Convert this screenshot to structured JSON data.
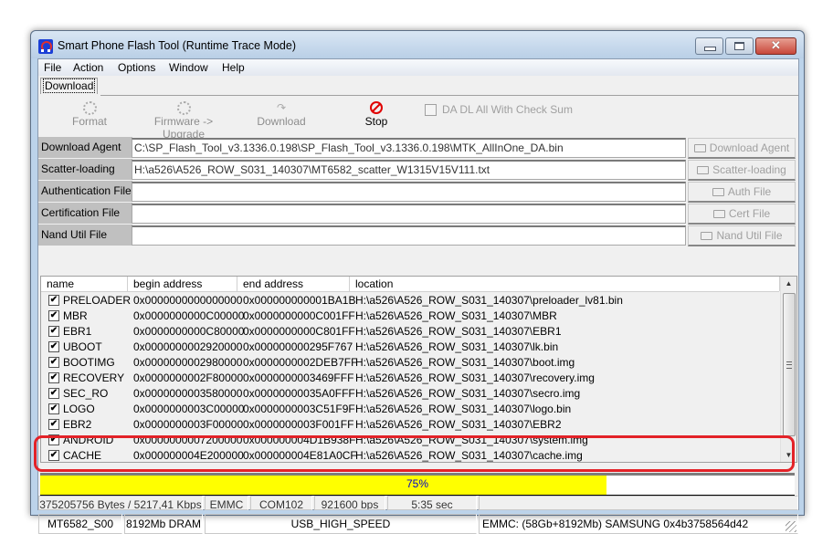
{
  "window": {
    "title": "Smart Phone Flash Tool (Runtime Trace Mode)",
    "close_glyph": "✕"
  },
  "menu": [
    "File",
    "Action",
    "Options",
    "Window",
    "Help"
  ],
  "tabs": [
    {
      "label": "Download",
      "active": true
    }
  ],
  "toolbar": {
    "buttons": [
      {
        "label": "Format",
        "icon": "gear-icon",
        "enabled": false
      },
      {
        "label": "Firmware -> Upgrade",
        "icon": "gear-icon",
        "enabled": false
      },
      {
        "label": "Download",
        "icon": "redo-icon",
        "enabled": false
      },
      {
        "label": "Stop",
        "icon": "stop-icon",
        "enabled": true
      }
    ],
    "checksum_checkbox": {
      "label": "DA DL All With Check Sum",
      "checked": false,
      "enabled": false
    }
  },
  "files": [
    {
      "label": "Download Agent",
      "value": "C:\\SP_Flash_Tool_v3.1336.0.198\\SP_Flash_Tool_v3.1336.0.198\\MTK_AllInOne_DA.bin",
      "button": "Download Agent"
    },
    {
      "label": "Scatter-loading File",
      "value": "H:\\a526\\A526_ROW_S031_140307\\MT6582_scatter_W1315V15V111.txt",
      "button": "Scatter-loading"
    },
    {
      "label": "Authentication File",
      "value": "",
      "button": "Auth File"
    },
    {
      "label": "Certification File",
      "value": "",
      "button": "Cert File"
    },
    {
      "label": "Nand Util File",
      "value": "",
      "button": "Nand Util File"
    }
  ],
  "table": {
    "columns": [
      "name",
      "begin address",
      "end address",
      "location"
    ],
    "rows": [
      {
        "checked": true,
        "name": "PRELOADER",
        "begin": "0x0000000000000000",
        "end": "0x000000000001BA1B",
        "location": "H:\\a526\\A526_ROW_S031_140307\\preloader_lv81.bin"
      },
      {
        "checked": true,
        "name": "MBR",
        "begin": "0x0000000000C00000",
        "end": "0x0000000000C001FF",
        "location": "H:\\a526\\A526_ROW_S031_140307\\MBR"
      },
      {
        "checked": true,
        "name": "EBR1",
        "begin": "0x0000000000C80000",
        "end": "0x0000000000C801FF",
        "location": "H:\\a526\\A526_ROW_S031_140307\\EBR1"
      },
      {
        "checked": true,
        "name": "UBOOT",
        "begin": "0x0000000002920000",
        "end": "0x000000000295F767",
        "location": "H:\\a526\\A526_ROW_S031_140307\\lk.bin"
      },
      {
        "checked": true,
        "name": "BOOTIMG",
        "begin": "0x0000000002980000",
        "end": "0x0000000002DEB7FF",
        "location": "H:\\a526\\A526_ROW_S031_140307\\boot.img"
      },
      {
        "checked": true,
        "name": "RECOVERY",
        "begin": "0x0000000002F80000",
        "end": "0x0000000003469FFF",
        "location": "H:\\a526\\A526_ROW_S031_140307\\recovery.img"
      },
      {
        "checked": true,
        "name": "SEC_RO",
        "begin": "0x0000000003580000",
        "end": "0x00000000035A0FFF",
        "location": "H:\\a526\\A526_ROW_S031_140307\\secro.img"
      },
      {
        "checked": true,
        "name": "LOGO",
        "begin": "0x0000000003C00000",
        "end": "0x0000000003C51F9F",
        "location": "H:\\a526\\A526_ROW_S031_140307\\logo.bin"
      },
      {
        "checked": true,
        "name": "EBR2",
        "begin": "0x0000000003F00000",
        "end": "0x0000000003F001FF",
        "location": "H:\\a526\\A526_ROW_S031_140307\\EBR2"
      },
      {
        "checked": true,
        "name": "ANDROID",
        "begin": "0x0000000007200000",
        "end": "0x000000004D1B938F",
        "location": "H:\\a526\\A526_ROW_S031_140307\\system.img"
      },
      {
        "checked": true,
        "name": "CACHE",
        "begin": "0x000000004E200000",
        "end": "0x000000004E81A0CF",
        "location": "H:\\a526\\A526_ROW_S031_140307\\cache.img"
      }
    ]
  },
  "progress": {
    "percent": 75,
    "label": "75%",
    "fill_color": "#ffff00",
    "text_color": "#0000cc"
  },
  "status_transfer": [
    "375205756 Bytes / 5217,41 Kbps",
    "EMMC",
    "COM102",
    "921600 bps",
    "5:35 sec",
    ""
  ],
  "status_device": [
    "MT6582_S00",
    "8192Mb DRAM",
    "USB_HIGH_SPEED",
    "EMMC: (58Gb+8192Mb) SAMSUNG 0x4b3758564d42"
  ],
  "annotation_color": "#e32228"
}
